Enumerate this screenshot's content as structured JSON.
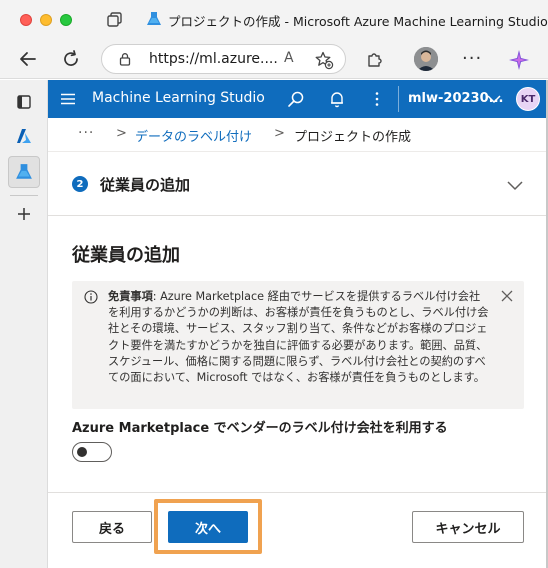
{
  "browser": {
    "tab_title": "プロジェクトの作成 - Microsoft Azure Machine Learning Studio",
    "url": "https://ml.azure....",
    "read_aloud_label": "A"
  },
  "app": {
    "title": "Machine Learning Studio",
    "workspace": "mlw-20230...",
    "user_initials": "KT",
    "brand_color": "#0f6cbd"
  },
  "breadcrumb": {
    "more": "···",
    "separator": ">",
    "parent": "データのラベル付け",
    "current": "プロジェクトの作成"
  },
  "step": {
    "number": "2",
    "title": "従業員の追加"
  },
  "content": {
    "heading": "従業員の追加",
    "notice": {
      "bold": "免責事項",
      "text": ": Azure Marketplace 経由でサービスを提供するラベル付け会社を利用するかどうかの判断は、お客様が責任を負うものとし、ラベル付け会社とその環境、サービス、スタッフ割り当て、条件などがお客様のプロジェクト要件を満たすかどうかを独自に評価する必要があります。範囲、品質、スケジュール、価格に関する問題に限らず、ラベル付け会社との契約のすべての面において、Microsoft ではなく、お客様が責任を負うものとします。"
    },
    "toggle_label": "Azure Marketplace でベンダーのラベル付け会社を利用する",
    "toggle_on": false
  },
  "footer": {
    "back": "戻る",
    "next": "次へ",
    "cancel": "キャンセル",
    "highlight_color": "#f0a250"
  },
  "icons": [
    "tabs-icon",
    "azure-ml-icon",
    "back-arrow-icon",
    "refresh-icon",
    "lock-icon",
    "favorites-add-icon",
    "extensions-icon",
    "copilot-icon",
    "hamburger-icon",
    "search-icon",
    "bell-icon",
    "more-vertical-icon",
    "chevron-down-icon",
    "info-icon",
    "close-icon",
    "plus-icon",
    "azure-icon"
  ]
}
